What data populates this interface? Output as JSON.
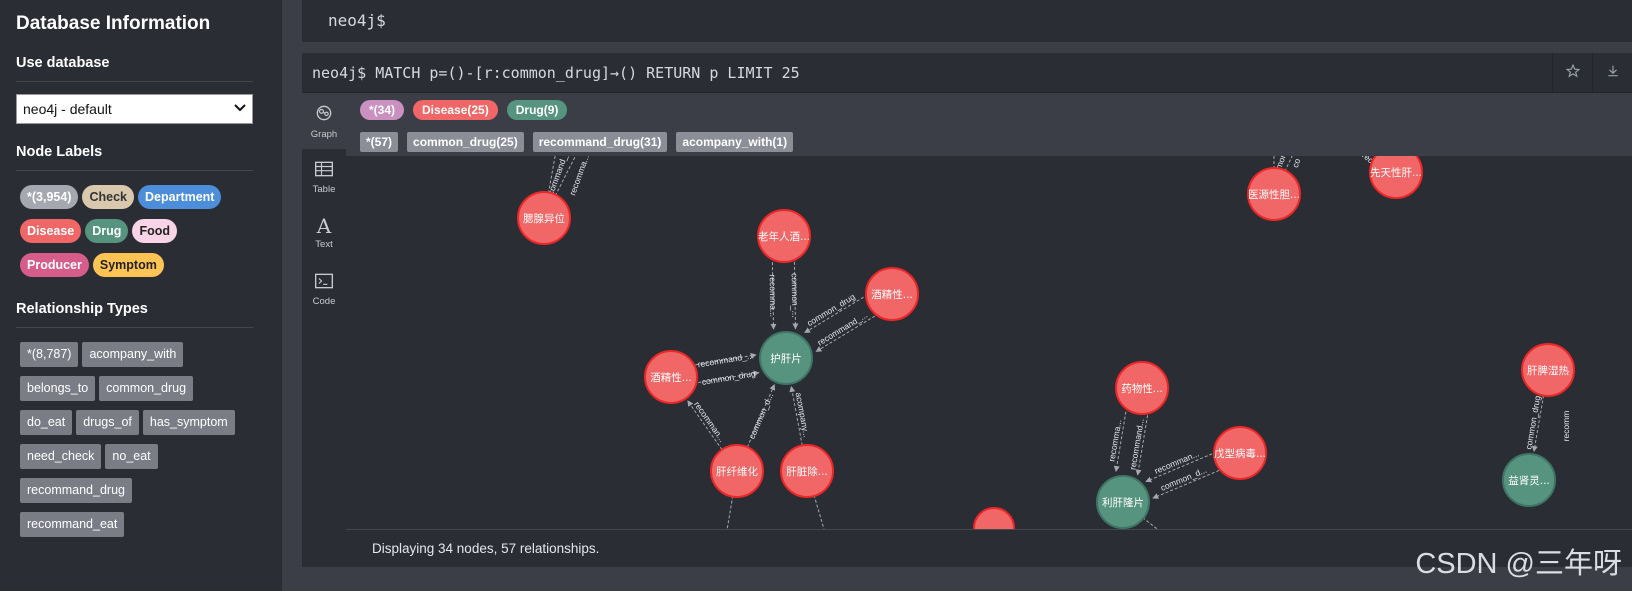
{
  "sidebar": {
    "title": "Database Information",
    "use_db_heading": "Use database",
    "db_select_value": "neo4j - default",
    "node_labels_heading": "Node Labels",
    "node_labels": [
      {
        "label": "*(3,954)",
        "color": "#a5a8b0",
        "text": "#ffffff"
      },
      {
        "label": "Check",
        "color": "#d9c8ae",
        "text": "#333333"
      },
      {
        "label": "Department",
        "color": "#4c8eda",
        "text": "#ffffff"
      },
      {
        "label": "Disease",
        "color": "#f16667",
        "text": "#ffffff"
      },
      {
        "label": "Drug",
        "color": "#57c7e3",
        "text": "#ffffff"
      },
      {
        "label": "Food",
        "color": "#f9d4e6",
        "text": "#222222"
      },
      {
        "label": "Producer",
        "color": "#d65d89",
        "text": "#ffffff"
      },
      {
        "label": "Symptom",
        "color": "#ffc454",
        "text": "#222222"
      }
    ],
    "rel_types_heading": "Relationship Types",
    "rel_types": [
      "*(8,787)",
      "acompany_with",
      "belongs_to",
      "common_drug",
      "do_eat",
      "drugs_of",
      "has_symptom",
      "need_check",
      "no_eat",
      "recommand_drug",
      "recommand_eat"
    ]
  },
  "editor": {
    "prompt": "neo4j$"
  },
  "frame": {
    "query": "neo4j$ MATCH p=()-[r:common_drug]→() RETURN p LIMIT 25",
    "tabs": [
      {
        "label": "Graph",
        "icon": "graph-icon"
      },
      {
        "label": "Table",
        "icon": "table-icon"
      },
      {
        "label": "Text",
        "icon": "text-icon"
      },
      {
        "label": "Code",
        "icon": "code-icon"
      }
    ],
    "legend_nodes": [
      {
        "label": "*(34)",
        "color": "#c990c0"
      },
      {
        "label": "Disease(25)",
        "color": "#f16667"
      },
      {
        "label": "Drug(9)",
        "color": "#569480"
      }
    ],
    "legend_rels": [
      "*(57)",
      "common_drug(25)",
      "recommand_drug(31)",
      "acompany_with(1)"
    ],
    "status": "Displaying 34 nodes, 57 relationships."
  },
  "graph": {
    "disease_color": "#f16667",
    "drug_color": "#569480",
    "nodes": [
      {
        "id": "n1",
        "type": "disease",
        "caption": "腮腺异位"
      },
      {
        "id": "n2",
        "type": "disease",
        "caption": "老年人酒..."
      },
      {
        "id": "n3",
        "type": "disease",
        "caption": "酒精性..."
      },
      {
        "id": "n4",
        "type": "drug",
        "caption": "护肝片"
      },
      {
        "id": "n5",
        "type": "disease",
        "caption": "酒精性..."
      },
      {
        "id": "n6",
        "type": "disease",
        "caption": "肝纤维化"
      },
      {
        "id": "n7",
        "type": "disease",
        "caption": "肝脏除..."
      },
      {
        "id": "n8",
        "type": "disease",
        "caption": "医源性胆..."
      },
      {
        "id": "n9",
        "type": "disease",
        "caption": "先天性肝..."
      },
      {
        "id": "n10",
        "type": "disease",
        "caption": "药物性..."
      },
      {
        "id": "n11",
        "type": "disease",
        "caption": "戊型病毒..."
      },
      {
        "id": "n12",
        "type": "drug",
        "caption": "利肝隆片"
      },
      {
        "id": "n13",
        "type": "disease",
        "caption": "肝脾湿热"
      },
      {
        "id": "n14",
        "type": "drug",
        "caption": "益肾灵..."
      },
      {
        "id": "n15",
        "type": "disease",
        "caption": ""
      }
    ],
    "edge_labels": [
      "common_...",
      "recomma...",
      "recommand_...",
      "common_drug",
      "recommand_...",
      "common_drug",
      "recomman...",
      "common_d...",
      "acompany...",
      "recommand...",
      "recomma...",
      "common_d...",
      "recomman...",
      "common_drug",
      "recommand_...",
      "recomma...",
      "common_...",
      "co",
      "rec",
      "recomm"
    ]
  },
  "watermark": "CSDN @三年呀"
}
